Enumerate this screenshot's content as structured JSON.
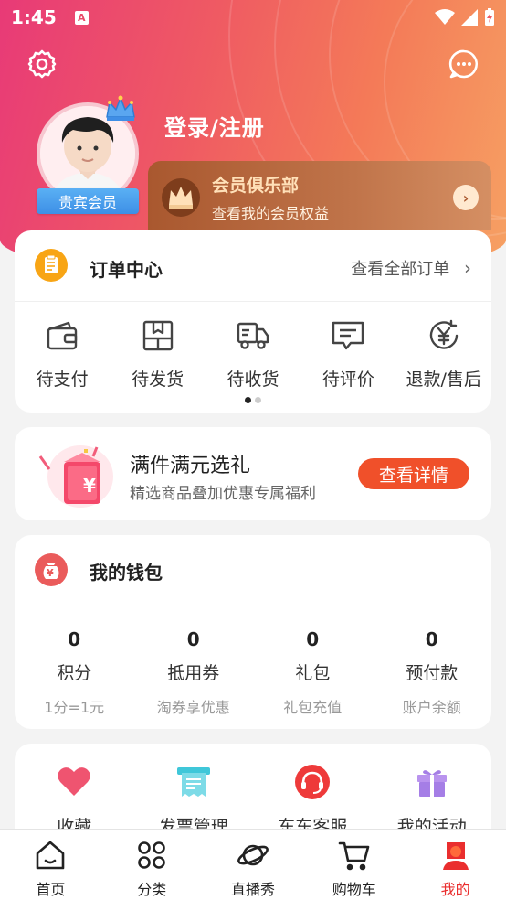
{
  "status_bar": {
    "time": "1:45",
    "notification": "A"
  },
  "profile": {
    "login_label": "登录/注册",
    "badge": "贵宾会员"
  },
  "member_club": {
    "title": "会员俱乐部",
    "subtitle": "查看我的会员权益"
  },
  "order_center": {
    "title": "订单中心",
    "more": "查看全部订单",
    "items": [
      {
        "label": "待支付",
        "icon": "wallet-icon"
      },
      {
        "label": "待发货",
        "icon": "box-icon"
      },
      {
        "label": "待收货",
        "icon": "truck-icon"
      },
      {
        "label": "待评价",
        "icon": "comment-icon"
      },
      {
        "label": "退款/售后",
        "icon": "refund-icon"
      }
    ]
  },
  "promo": {
    "title": "满件满元选礼",
    "subtitle": "精选商品叠加优惠专属福利",
    "button": "查看详情",
    "gift_symbol": "¥"
  },
  "wallet": {
    "title": "我的钱包",
    "icon_symbol": "¥",
    "items": [
      {
        "value": "0",
        "name": "积分",
        "hint": "1分=1元"
      },
      {
        "value": "0",
        "name": "抵用券",
        "hint": "淘券享优惠"
      },
      {
        "value": "0",
        "name": "礼包",
        "hint": "礼包充值"
      },
      {
        "value": "0",
        "name": "预付款",
        "hint": "账户余额"
      }
    ]
  },
  "services": [
    {
      "label": "收藏",
      "icon": "heart-icon",
      "color": "#ef5470"
    },
    {
      "label": "发票管理",
      "icon": "invoice-icon",
      "color": "#3fc7d9"
    },
    {
      "label": "东东客服",
      "icon": "headset-icon",
      "color": "#ee3a3a"
    },
    {
      "label": "我的活动",
      "icon": "gift-icon",
      "color": "#a57ee6"
    }
  ],
  "tabbar": [
    {
      "label": "首页",
      "icon": "home-icon",
      "active": false
    },
    {
      "label": "分类",
      "icon": "category-icon",
      "active": false
    },
    {
      "label": "直播秀",
      "icon": "planet-icon",
      "active": false
    },
    {
      "label": "购物车",
      "icon": "cart-icon",
      "active": false
    },
    {
      "label": "我的",
      "icon": "profile-icon",
      "active": true
    }
  ],
  "colors": {
    "accent": "#f0502a",
    "active_tab": "#ea2e2e",
    "member_gold": "#ffe0b8",
    "vip_blue": "#3d8fe6"
  }
}
